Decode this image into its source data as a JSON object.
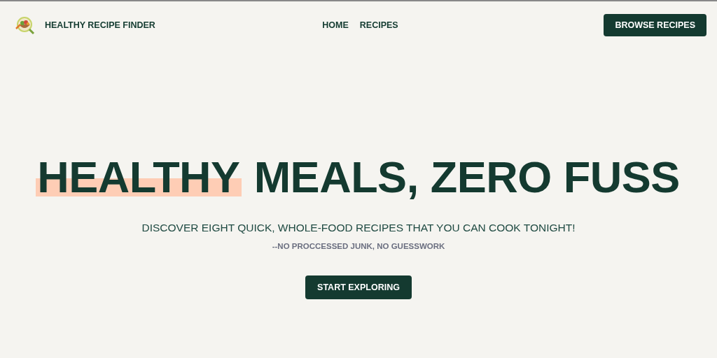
{
  "header": {
    "brand": "HEALTHY RECIPE FINDER",
    "nav": [
      {
        "label": "HOME"
      },
      {
        "label": "RECIPES"
      }
    ],
    "cta": "BROWSE RECIPES"
  },
  "hero": {
    "title": [
      {
        "text": "HEALTHY",
        "highlighted": true
      },
      {
        "text": "MEALS, ZERO FUSS",
        "highlighted": false
      }
    ],
    "subtitle": "DISCOVER EIGHT QUICK, WHOLE-FOOD RECIPES THAT YOU CAN COOK TONIGHT!",
    "tagline": "--NO PROCCESSED JUNK, NO GUESSWORK",
    "button": "START EXPLORING"
  }
}
